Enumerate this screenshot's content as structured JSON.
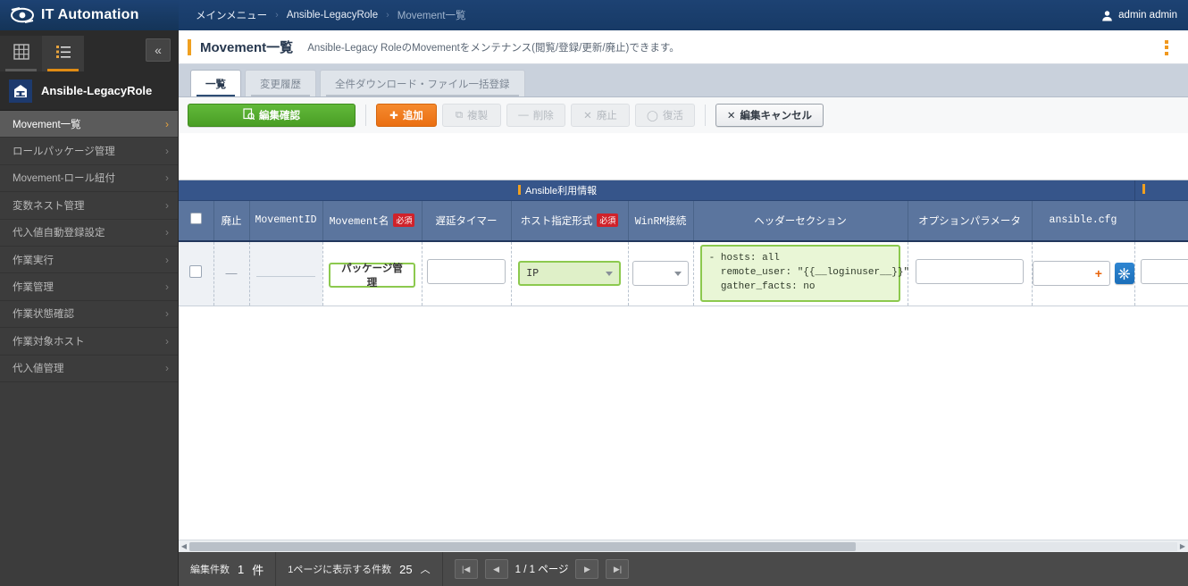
{
  "navbar": {
    "brand": "IT Automation",
    "logo_icon": "eye-logo-icon",
    "breadcrumb": [
      {
        "label": "メインメニュー",
        "dim": false
      },
      {
        "label": "Ansible-LegacyRole",
        "dim": false
      },
      {
        "label": "Movement一覧",
        "dim": true
      }
    ],
    "separator": "›",
    "user": {
      "name": "admin admin",
      "icon": "user-icon"
    }
  },
  "sidebar": {
    "tabs": [
      {
        "icon": "grid-view-icon",
        "active": false
      },
      {
        "icon": "list-view-icon",
        "active": true
      }
    ],
    "collapse_icon": "«",
    "group": {
      "name": "Ansible-LegacyRole",
      "icon": "legacy-role-icon"
    },
    "items": [
      {
        "label": "Movement一覧",
        "active": true
      },
      {
        "label": "ロールパッケージ管理",
        "active": false
      },
      {
        "label": "Movement-ロール紐付",
        "active": false
      },
      {
        "label": "変数ネスト管理",
        "active": false
      },
      {
        "label": "代入値自動登録設定",
        "active": false
      },
      {
        "label": "作業実行",
        "active": false
      },
      {
        "label": "作業管理",
        "active": false
      },
      {
        "label": "作業状態確認",
        "active": false
      },
      {
        "label": "作業対象ホスト",
        "active": false
      },
      {
        "label": "代入値管理",
        "active": false
      }
    ],
    "chevron": "›"
  },
  "page": {
    "title": "Movement一覧",
    "description": "Ansible-Legacy RoleのMovementをメンテナンス(閲覧/登録/更新/廃止)できます。",
    "kebab_icon": "vertical-dots-icon"
  },
  "tabs": [
    {
      "label": "一覧",
      "active": true
    },
    {
      "label": "変更履歴",
      "active": false
    },
    {
      "label": "全件ダウンロード・ファイル一括登録",
      "active": false
    }
  ],
  "toolbar": {
    "confirm": {
      "label": "編集確認",
      "icon": "document-check-icon",
      "state": "primary"
    },
    "add": {
      "label": "追加",
      "icon": "plus-icon",
      "state": "accent"
    },
    "duplicate": {
      "label": "複製",
      "icon": "copy-icon",
      "state": "disabled"
    },
    "delete": {
      "label": "削除",
      "icon": "minus-icon",
      "state": "disabled"
    },
    "discard": {
      "label": "廃止",
      "icon": "x-icon",
      "state": "disabled"
    },
    "restore": {
      "label": "復活",
      "icon": "circle-icon",
      "state": "disabled"
    },
    "cancel": {
      "label": "編集キャンセル",
      "icon": "x-icon",
      "state": "default"
    }
  },
  "table": {
    "group_headers": [
      {
        "label": "Ansible利用情報",
        "accent_color": "#f0a020"
      }
    ],
    "columns": [
      {
        "key": "select",
        "label": "",
        "icon": "header-checkbox",
        "required": false,
        "mono": false
      },
      {
        "key": "discard",
        "label": "廃止",
        "required": false,
        "mono": true
      },
      {
        "key": "movement_id",
        "label": "MovementID",
        "required": false,
        "mono": true
      },
      {
        "key": "movement_name",
        "label": "Movement名",
        "required": true,
        "mono": true
      },
      {
        "key": "delay_timer",
        "label": "遅延タイマー",
        "required": false,
        "mono": false
      },
      {
        "key": "host_format",
        "label": "ホスト指定形式",
        "required": true,
        "mono": false
      },
      {
        "key": "winrm",
        "label": "WinRM接続",
        "required": false,
        "mono": true
      },
      {
        "key": "header_section",
        "label": "ヘッダーセクション",
        "required": false,
        "mono": false
      },
      {
        "key": "option_param",
        "label": "オプションパラメータ",
        "required": false,
        "mono": false
      },
      {
        "key": "ansible_cfg",
        "label": "ansible.cfg",
        "required": false,
        "mono": true
      },
      {
        "key": "overflow",
        "label": "",
        "required": false,
        "mono": false
      }
    ],
    "required_badge": "必須",
    "rows": [
      {
        "select": "",
        "discard": "—",
        "movement_id": "",
        "movement_name": "パッケージ管理",
        "delay_timer": "",
        "host_format": "IP",
        "winrm": "",
        "header_section": "- hosts: all\n  remote_user: \"{{__loginuser__}}\"\n  gather_facts: no",
        "option_param": "",
        "ansible_cfg": "+",
        "ansible_cfg_icon": "settings-burst-icon"
      }
    ]
  },
  "footer": {
    "edit_count_label": "編集件数",
    "edit_count_value": "1",
    "edit_count_unit": "件",
    "page_size_label": "1ページに表示する件数",
    "page_size_value": "25",
    "page_size_caret": "︿",
    "pager": {
      "first": "|◀",
      "prev": "◀",
      "text": "1 / 1 ページ",
      "next": "▶",
      "last": "▶|"
    }
  }
}
